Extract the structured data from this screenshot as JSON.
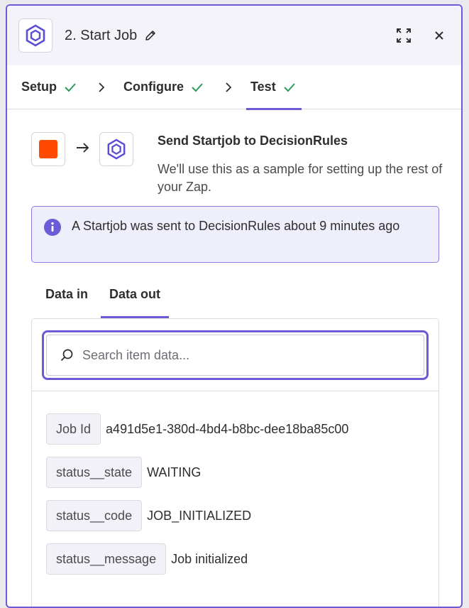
{
  "header": {
    "title": "2. Start Job"
  },
  "tabs": [
    {
      "label": "Setup"
    },
    {
      "label": "Configure"
    },
    {
      "label": "Test"
    }
  ],
  "send": {
    "title": "Send Startjob to DecisionRules",
    "description": "We'll use this as a sample for setting up the rest of your Zap."
  },
  "info": {
    "text": "A Startjob was sent to DecisionRules about 9 minutes ago"
  },
  "data_tabs": [
    {
      "label": "Data in"
    },
    {
      "label": "Data out"
    }
  ],
  "search": {
    "placeholder": "Search item data..."
  },
  "fields": [
    {
      "key": "Job Id",
      "value": "a491d5e1-380d-4bd4-b8bc-dee18ba85c00"
    },
    {
      "key": "status__state",
      "value": "WAITING"
    },
    {
      "key": "status__code",
      "value": "JOB_INITIALIZED"
    },
    {
      "key": "status__message",
      "value": "Job initialized"
    }
  ],
  "colors": {
    "accent": "#6b5bd6",
    "check": "#2e9b5b",
    "zapier_orange": "#ff4a00"
  },
  "icons": [
    "decisionrules-hexagon-icon",
    "pencil-icon",
    "expand-icon",
    "close-icon",
    "check-icon",
    "chevron-right-icon",
    "arrow-right-icon",
    "info-icon",
    "search-icon"
  ]
}
